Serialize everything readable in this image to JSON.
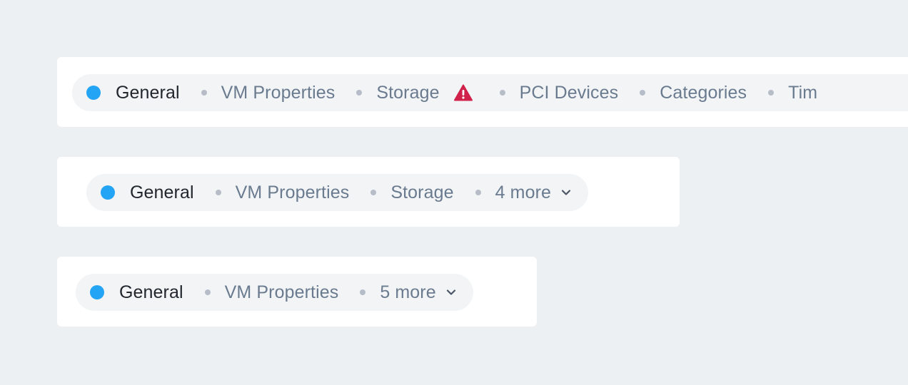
{
  "row1": {
    "steps": [
      {
        "label": "General"
      },
      {
        "label": "VM Properties"
      },
      {
        "label": "Storage"
      },
      {
        "label": "PCI Devices"
      },
      {
        "label": "Categories"
      },
      {
        "label": "Tim"
      }
    ]
  },
  "row2": {
    "steps": [
      {
        "label": "General"
      },
      {
        "label": "VM Properties"
      },
      {
        "label": "Storage"
      }
    ],
    "more_label": "4 more"
  },
  "row3": {
    "steps": [
      {
        "label": "General"
      },
      {
        "label": "VM Properties"
      }
    ],
    "more_label": "5 more"
  },
  "icons": {
    "active_step": "blue-dot-icon",
    "inactive_step": "gray-dot-icon",
    "warning": "warning-triangle-icon",
    "overflow": "chevron-down-icon"
  },
  "colors": {
    "active_dot": "#24a4f5",
    "inactive_dot": "#b6bdc8",
    "warning": "#d0224b",
    "active_text": "#22272e",
    "inactive_text": "#6a7b8f",
    "pill_bg": "#f2f4f6",
    "page_bg": "#edf0f3"
  }
}
